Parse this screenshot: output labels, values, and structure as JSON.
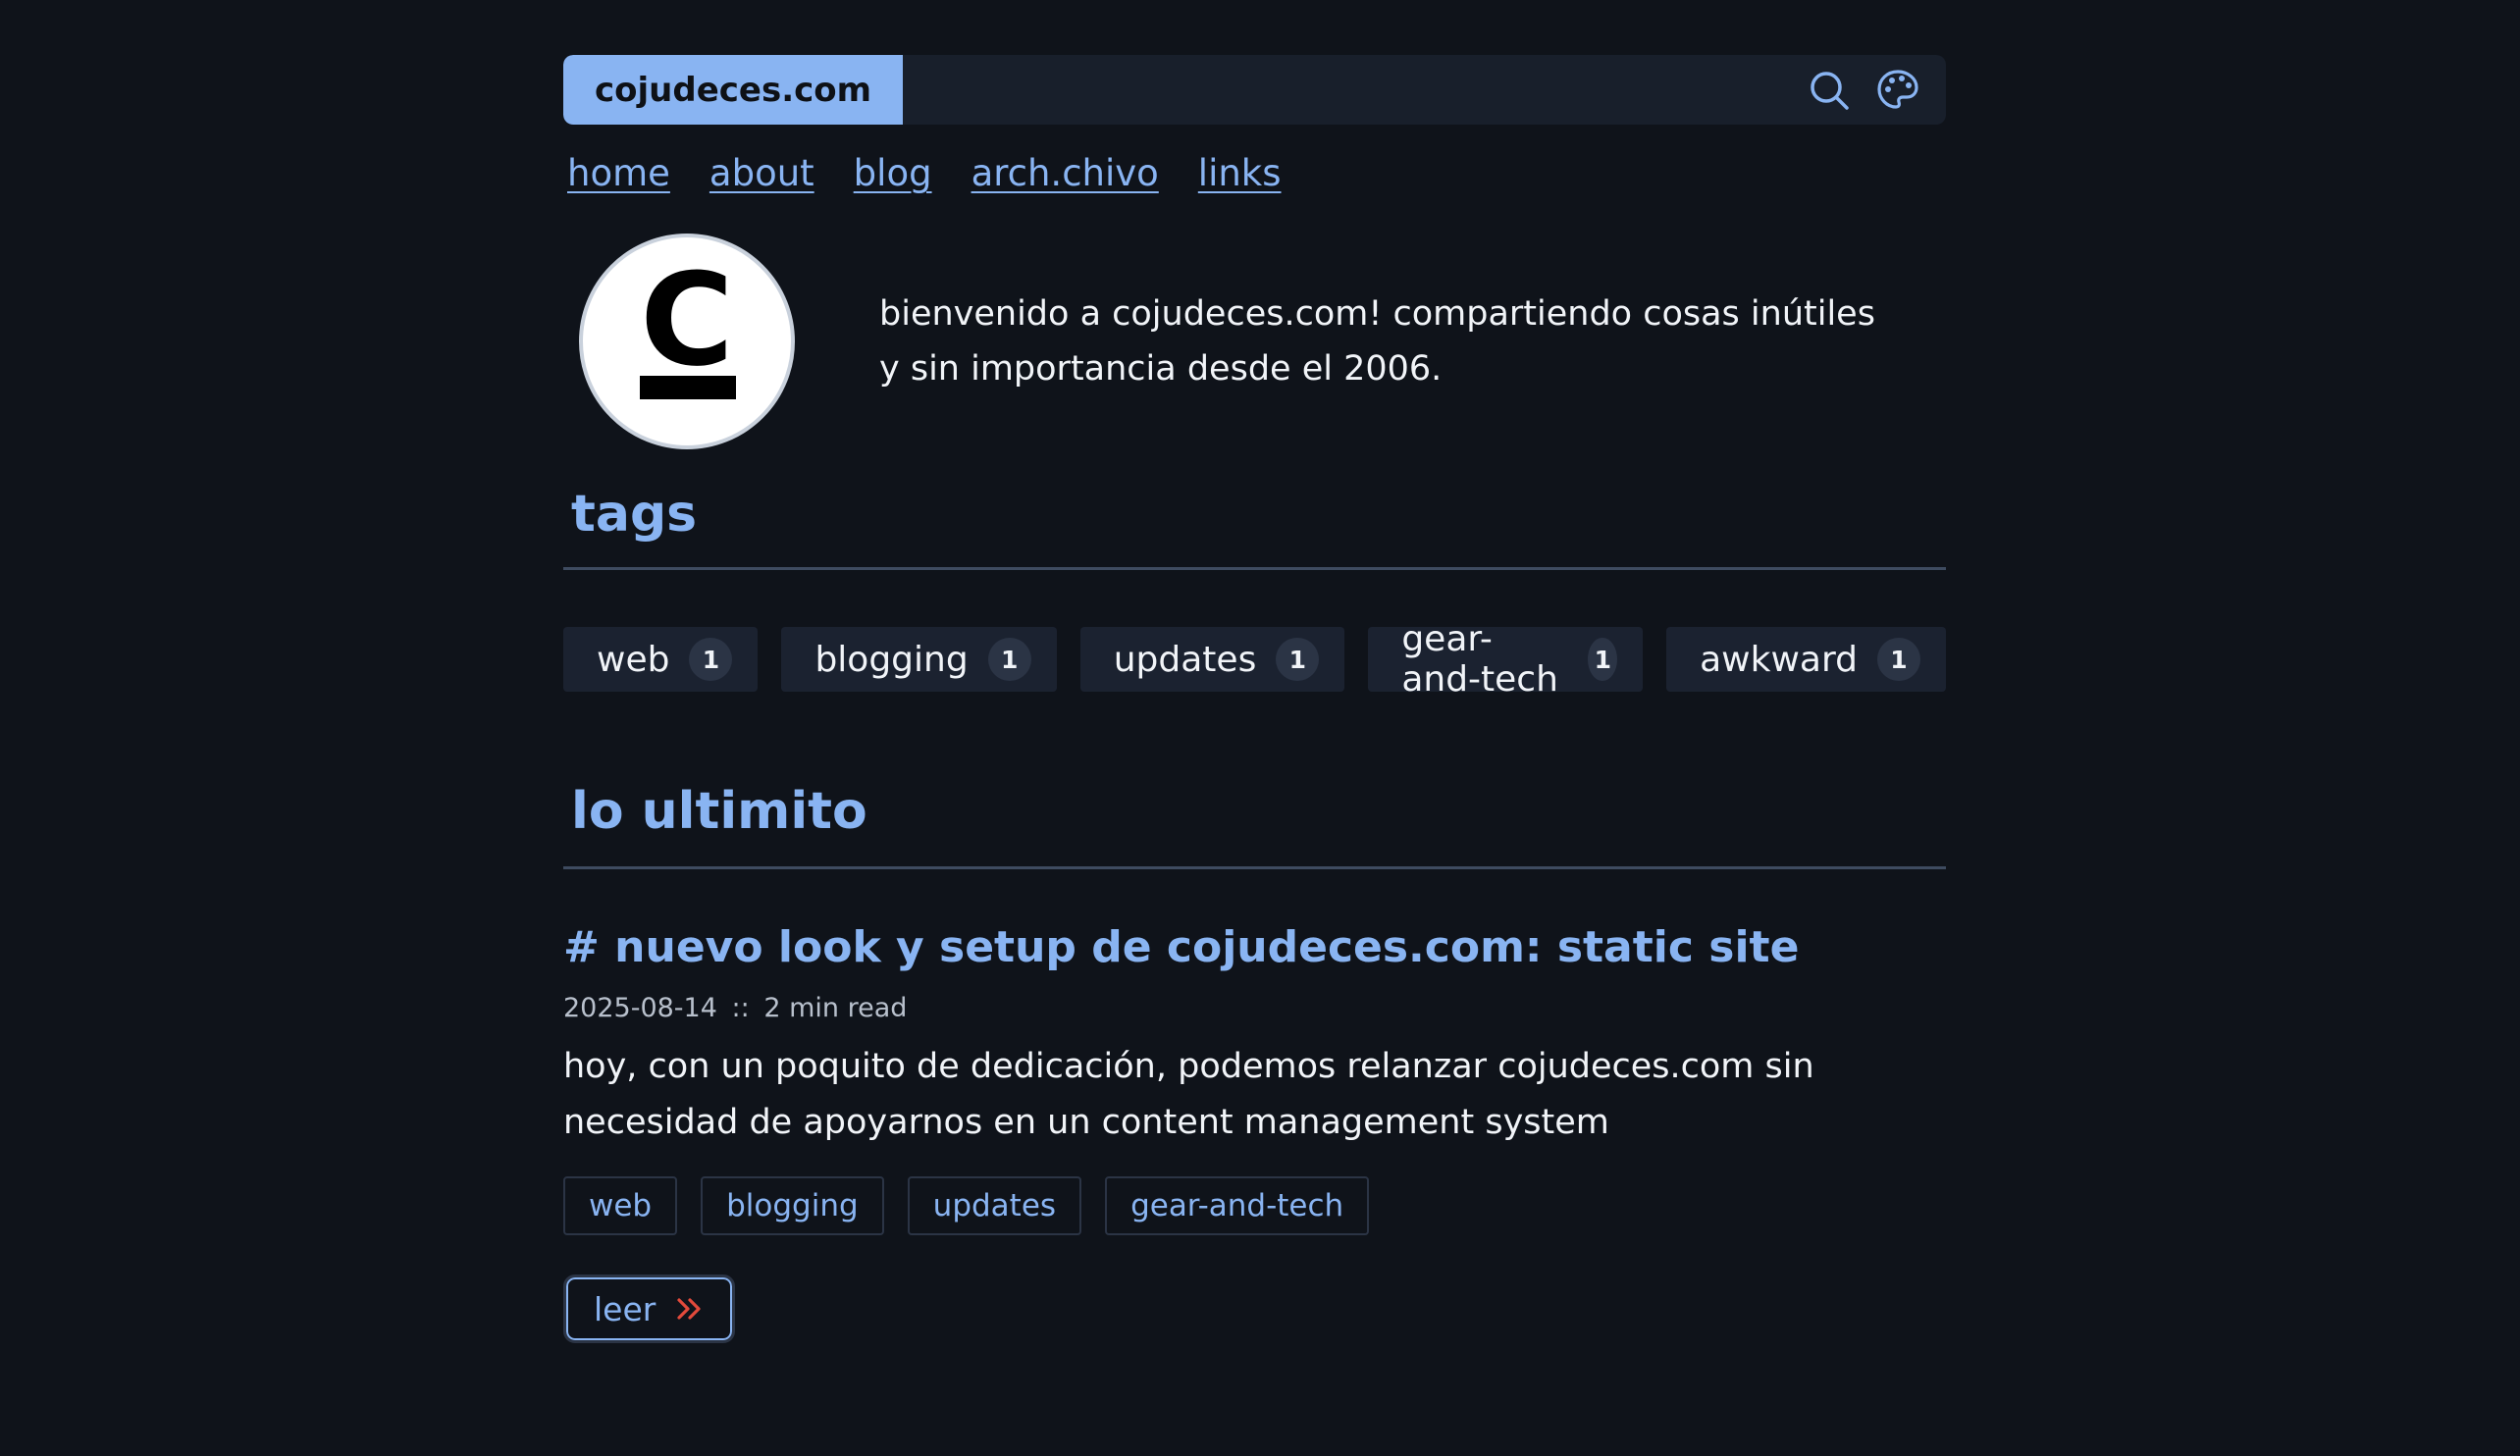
{
  "header": {
    "site_name": "cojudeces.com",
    "icons": [
      "search-icon",
      "palette-icon"
    ]
  },
  "nav": {
    "items": [
      "home",
      "about",
      "blog",
      "arch.chivo",
      "links"
    ]
  },
  "intro": {
    "avatar_letter": "C",
    "text": "bienvenido a cojudeces.com! compartiendo cosas inútiles y sin importancia desde el 2006."
  },
  "tags_section": {
    "title": "tags",
    "tags": [
      {
        "name": "web",
        "count": "1"
      },
      {
        "name": "blogging",
        "count": "1"
      },
      {
        "name": "updates",
        "count": "1"
      },
      {
        "name": "gear-and-tech",
        "count": "1"
      },
      {
        "name": "awkward",
        "count": "1"
      }
    ]
  },
  "latest_section": {
    "title": "lo ultimito",
    "post": {
      "title": "# nuevo look y setup de cojudeces.com: static site",
      "date": "2025-08-14",
      "separator": "::",
      "read_time": "2 min read",
      "summary": "hoy, con un poquito de dedicación, podemos relanzar cojudeces.com sin necesidad de apoyarnos en un content management system",
      "tags": [
        "web",
        "blogging",
        "updates",
        "gear-and-tech"
      ],
      "read_label": "leer"
    }
  },
  "colors": {
    "background": "#0f131a",
    "accent": "#89b4f2",
    "surface": "#1b2230",
    "arrow": "#e24a3b"
  }
}
